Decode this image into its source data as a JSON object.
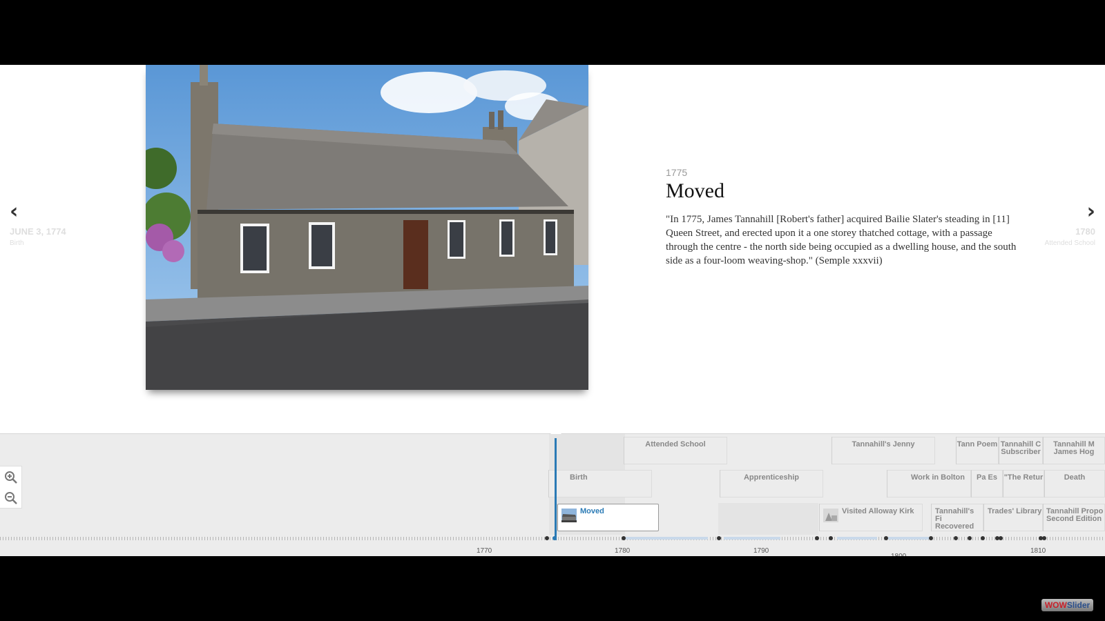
{
  "slide": {
    "date": "1775",
    "title": "Moved",
    "body": "\"In 1775, James Tannahill [Robert's father] acquired Bailie Slater's steading in [11] Queen Street, and erected upon it a one storey thatched cottage, with a passage through the centre - the north side being occupied as a dwelling house, and the south side as a four-loom weaving-shop.\" (Semple xxxvii)"
  },
  "nav": {
    "prev": {
      "arrow": "‹",
      "date": "JUNE 3, 1774",
      "label": "Birth",
      "icon": "chevron-left-icon"
    },
    "next": {
      "arrow": "›",
      "date": "1780",
      "label": "Attended School",
      "icon": "chevron-right-icon"
    }
  },
  "timenav": {
    "markers": [
      {
        "label": "Attended School"
      },
      {
        "label": "Tannahill's Jenny"
      },
      {
        "label": "Tann Poem"
      },
      {
        "label": "Tannahill C Subscriber"
      },
      {
        "label": "Tannahill M James Hog"
      },
      {
        "label": "Birth"
      },
      {
        "label": "Apprenticeship"
      },
      {
        "label": "Work in Bolton"
      },
      {
        "label": "Pa Es"
      },
      {
        "label": "\"The Retur"
      },
      {
        "label": "Death"
      },
      {
        "label": "Moved",
        "active": true
      },
      {
        "label": "Visited Alloway Kirk"
      },
      {
        "label": "Tannahill's Fi Recovered Le"
      },
      {
        "label": "Trades' Library"
      },
      {
        "label": "Tannahill Propo Second Edition"
      }
    ],
    "years": [
      "1770",
      "1780",
      "1790",
      "1800",
      "1810"
    ],
    "zoom_in_icon": "zoom-in-icon",
    "zoom_out_icon": "zoom-out-icon"
  },
  "brand": {
    "part1": "WOW",
    "part2": "Slider"
  },
  "colors": {
    "accent": "#2a7ab5",
    "background": "#000000",
    "timeline": "#ececec"
  }
}
